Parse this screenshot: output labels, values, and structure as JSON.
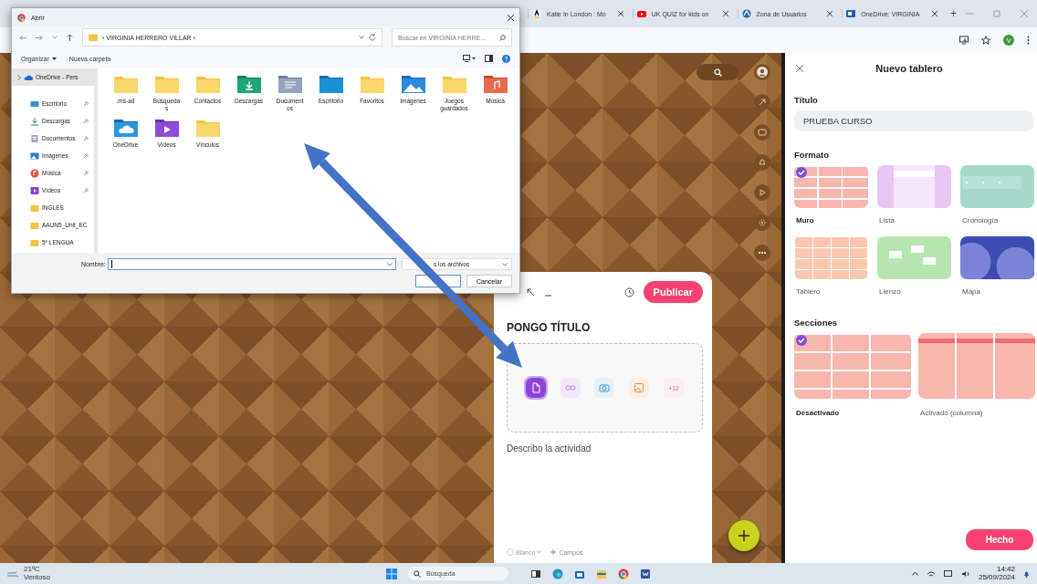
{
  "browser": {
    "tabs": [
      {
        "title": "Katie In London : Mo",
        "kind": "letter"
      },
      {
        "title": "UK QUIZ for kids on",
        "kind": "video"
      },
      {
        "title": "Zona de Usuarios",
        "kind": "wave"
      },
      {
        "title": "OneDrive: VIRGINIA",
        "kind": "mail"
      }
    ],
    "new_tab": "+",
    "profile": "V"
  },
  "dialog": {
    "title": "Abrir",
    "path": "› VIRGINIA HERRERO VILLAR ›",
    "search_placeholder": "Buscar en VIRGINIA HERRE...",
    "organize": "Organizar",
    "new_folder": "Nueva carpeta",
    "sidebar": [
      {
        "label": "OneDrive - Pers",
        "kind": "onedrive",
        "pinned": false,
        "selected": true
      },
      {
        "label": "Escritorio",
        "kind": "desktop",
        "pinned": true,
        "selected": false
      },
      {
        "label": "Descargas",
        "kind": "download",
        "pinned": true,
        "selected": false
      },
      {
        "label": "Documentos",
        "kind": "documents",
        "pinned": true,
        "selected": false
      },
      {
        "label": "Imágenes",
        "kind": "pictures",
        "pinned": true,
        "selected": false
      },
      {
        "label": "Música",
        "kind": "music",
        "pinned": true,
        "selected": false
      },
      {
        "label": "Vídeos",
        "kind": "videos",
        "pinned": true,
        "selected": false
      },
      {
        "label": "INGLES",
        "kind": "folder",
        "pinned": false,
        "selected": false
      },
      {
        "label": "AAUN5_Unit_EC",
        "kind": "folder",
        "pinned": false,
        "selected": false
      },
      {
        "label": "5º LENGUA",
        "kind": "folder",
        "pinned": false,
        "selected": false
      }
    ],
    "items": [
      {
        "label": ".ms-ad",
        "kind": "folder"
      },
      {
        "label": "Búsquedas",
        "kind": "folder"
      },
      {
        "label": "Contactos",
        "kind": "folder"
      },
      {
        "label": "Descargas",
        "kind": "download"
      },
      {
        "label": "Documentos",
        "kind": "documents"
      },
      {
        "label": "Escritorio",
        "kind": "desktop"
      },
      {
        "label": "Favoritos",
        "kind": "folder"
      },
      {
        "label": "Imágenes",
        "kind": "pictures"
      },
      {
        "label": "Juegos guardados",
        "kind": "folder"
      },
      {
        "label": "Música",
        "kind": "music"
      },
      {
        "label": "OneDrive",
        "kind": "onedrive"
      },
      {
        "label": "Vídeos",
        "kind": "videos"
      },
      {
        "label": "Vínculos",
        "kind": "folder"
      }
    ],
    "name_label": "Nombre:",
    "file_type": "s los archivos",
    "cancel": "Cancelar"
  },
  "composer": {
    "publish": "Publicar",
    "title": "PONGO TÍTULO",
    "attachments": [
      {
        "kind": "file",
        "selected": true
      },
      {
        "kind": "link",
        "selected": false
      },
      {
        "kind": "camera",
        "selected": false
      },
      {
        "kind": "image",
        "selected": false
      },
      {
        "kind": "more",
        "label": "+12",
        "selected": false
      }
    ],
    "description": "Describo la actividad",
    "color_option": "Blanco",
    "fields": "Campos"
  },
  "panel": {
    "title": "Nuevo tablero",
    "title_label": "Título",
    "title_value": "PRUEBA CURSO",
    "format_label": "Formato",
    "formats": [
      {
        "label": "Muro",
        "kind": "wall",
        "selected": true
      },
      {
        "label": "Lista",
        "kind": "list",
        "selected": false
      },
      {
        "label": "Cronología",
        "kind": "timeline",
        "selected": false
      },
      {
        "label": "Tablero",
        "kind": "grid",
        "selected": false
      },
      {
        "label": "Lienzo",
        "kind": "canvas",
        "selected": false
      },
      {
        "label": "Mapa",
        "kind": "map",
        "selected": false
      }
    ],
    "sections_label": "Secciones",
    "sections": [
      {
        "label": "Desactivado",
        "kind": "off",
        "selected": true
      },
      {
        "label": "Activado (columna)",
        "kind": "columns",
        "selected": false
      }
    ],
    "done": "Hecho"
  },
  "taskbar": {
    "temperature": "21ºC",
    "condition": "Ventoso",
    "search_placeholder": "Búsqueda",
    "time": "14:42",
    "date": "25/09/2024"
  }
}
